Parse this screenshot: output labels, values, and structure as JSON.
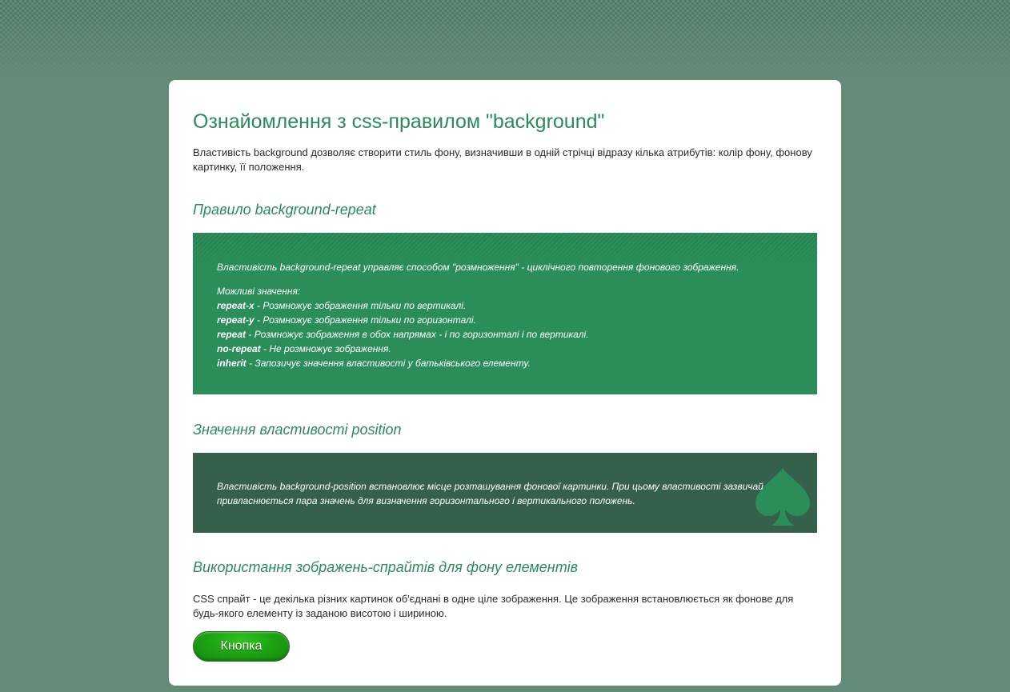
{
  "page": {
    "title": "Ознайомлення з css-правилом \"background\"",
    "intro": "Властивість background дозволяє створити стиль фону, визначивши в одній стрічці відразу кілька атрибутів: колір фону, фонову картинку, її положення."
  },
  "repeat_section": {
    "heading": "Правило background-repeat",
    "description": "Властивість background-repeat управляє способом \"розмноження\" - циклічного повторення фонового зображення.",
    "values_title": "Можливі значення:",
    "values": [
      {
        "name": "repeat-x",
        "text": " - Розмножує зображення тільки по вертикалі."
      },
      {
        "name": "repeat-y",
        "text": " - Розмножує зображення тільки по горизонталі."
      },
      {
        "name": "repeat",
        "text": " - Розмножує зображення в обох напрямах - і по горизонталі і по вертикалі."
      },
      {
        "name": "no-repeat",
        "text": " - Не розмножує зображення."
      },
      {
        "name": "inherit",
        "text": " - Запозичує значення властивості у батьківського елементу."
      }
    ]
  },
  "position_section": {
    "heading": "Значення властивості position",
    "description": "Властивість background-position встановлює місце розташування фонової картинки. При цьому властивості зазвичай привласнюється пара значень для визначення горизонтального і вертикального положень.",
    "icon": "spade-icon"
  },
  "sprite_section": {
    "heading": "Використання зображень-спрайтів для фону елементів",
    "description": "CSS спрайт - це декілька різних картинок об'єднані в одне ціле зображення. Це зображення встановлюється як фонове для будь-якого елементу із заданою висотою і шириною.",
    "button_label": "Кнопка"
  },
  "colors": {
    "page_background": "#638b78",
    "heading": "#2b8a5a",
    "repeat_box": "#2b8e5a",
    "position_box": "#35604b",
    "button": "#1ea414"
  }
}
